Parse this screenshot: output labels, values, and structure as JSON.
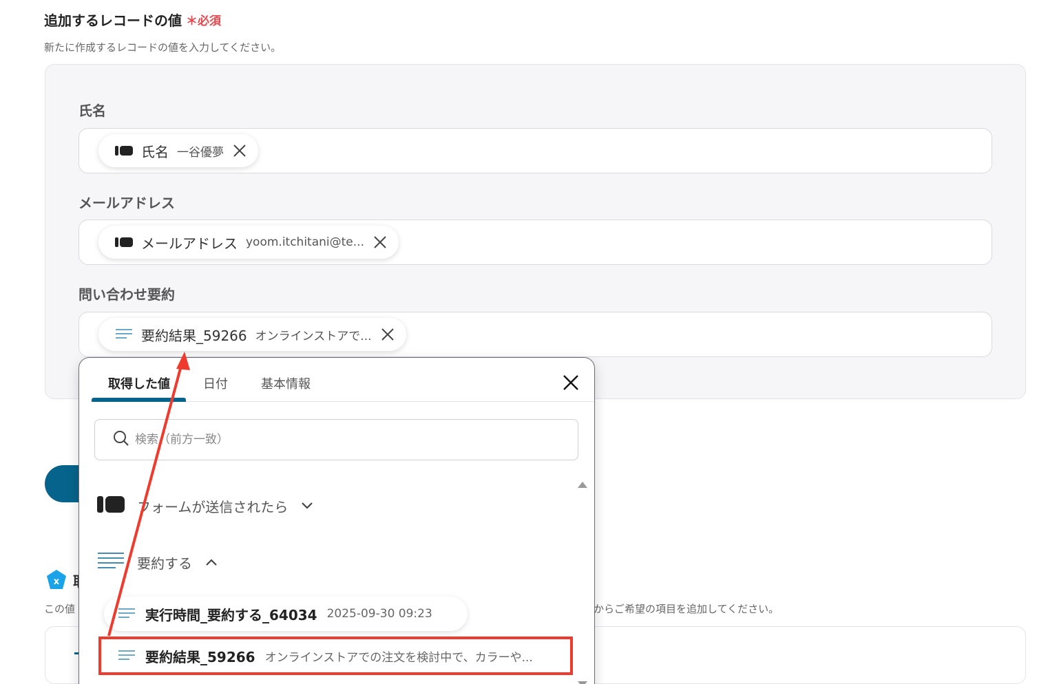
{
  "section": {
    "title": "追加するレコードの値",
    "required_label": "必須",
    "description": "新たに作成するレコードの値を入力してください。"
  },
  "fields": [
    {
      "label": "氏名",
      "chip": {
        "icon": "yoom-form-icon",
        "title": "氏名",
        "value": "一谷優夢"
      }
    },
    {
      "label": "メールアドレス",
      "chip": {
        "icon": "yoom-form-icon",
        "title": "メールアドレス",
        "value": "yoom.itchitani@te..."
      }
    },
    {
      "label": "問い合わせ要約",
      "chip": {
        "icon": "text-lines-icon",
        "title": "要約結果_59266",
        "value": "オンラインストアで..."
      }
    }
  ],
  "background_peek": {
    "partial_title_char": "取",
    "left_text": "この値",
    "right_text": "からご希望の項目を追加してください。"
  },
  "dropdown": {
    "tabs": [
      {
        "label": "取得した値",
        "active": true
      },
      {
        "label": "日付",
        "active": false
      },
      {
        "label": "基本情報",
        "active": false
      }
    ],
    "search_placeholder": "検索（前方一致）",
    "groups": [
      {
        "label": "フォームが送信されたら",
        "icon": "yoom-form-icon",
        "expanded": false
      },
      {
        "label": "要約する",
        "icon": "text-lines-icon",
        "expanded": true
      }
    ],
    "items": [
      {
        "title": "実行時間_要約する_64034",
        "value": "2025-09-30 09:23"
      },
      {
        "title": "要約結果_59266",
        "value": "オンラインストアでの注文を検討中で、カラーや..."
      }
    ]
  },
  "colors": {
    "accent": "#06648c",
    "required": "#e5484d",
    "annotation": "#ef3b2d",
    "panel_bg": "#f6f6f9"
  }
}
